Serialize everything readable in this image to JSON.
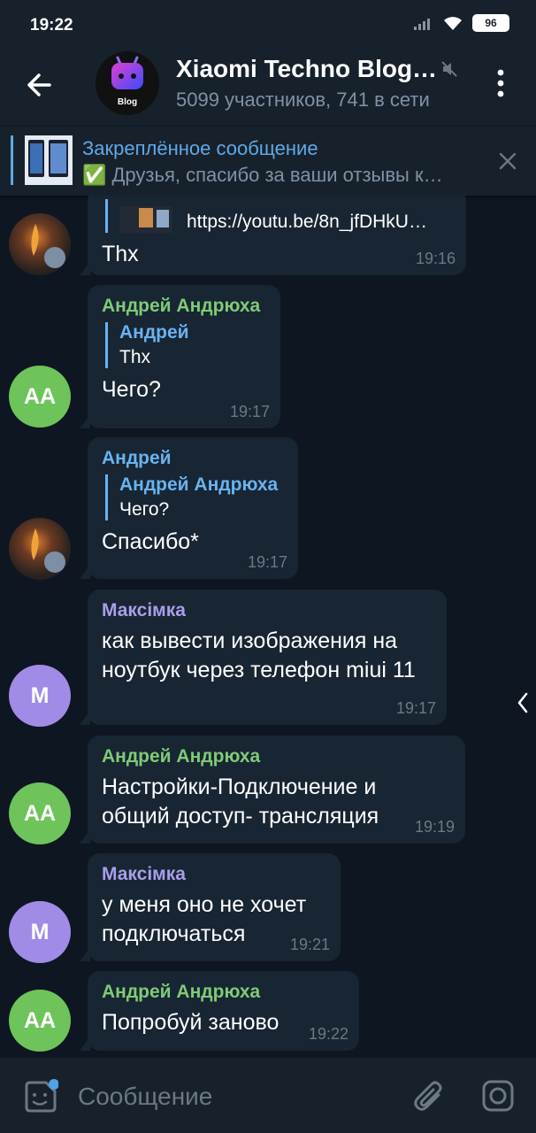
{
  "status_bar": {
    "time": "19:22",
    "battery": "96"
  },
  "header": {
    "title": "Xiaomi Techno Blog…",
    "subtitle": "5099 участников, 741 в сети",
    "avatar_text": "Blog"
  },
  "pinned": {
    "title": "Закреплённое сообщение",
    "text": "✅ Друзья, спасибо за ваши отзывы к…"
  },
  "messages": [
    {
      "avatar": "photo",
      "reply_partial": "https://youtu.be/8n_jfDHkU…",
      "text": "Thx",
      "time": "19:16"
    },
    {
      "avatar": "АА",
      "sender": "Андрей Андрюха",
      "reply_name": "Андрей",
      "reply_text": "Thx",
      "text": "Чего?",
      "time": "19:17"
    },
    {
      "avatar": "photo",
      "sender": "Андрей",
      "reply_name": "Андрей Андрюха",
      "reply_text": "Чего?",
      "text": "Спасибо*",
      "time": "19:17"
    },
    {
      "avatar": "М",
      "sender": "Максімка",
      "text": "как вывести изображения на ноутбук  через телефон miui 11",
      "time": "19:17"
    },
    {
      "avatar": "АА",
      "sender": "Андрей Андрюха",
      "text": "Настройки-Подключение и общий доступ- трансляция",
      "time": "19:19"
    },
    {
      "avatar": "М",
      "sender": "Максімка",
      "text": "у меня оно не хочет подключаться",
      "time": "19:21"
    },
    {
      "avatar": "АА",
      "sender": "Андрей Андрюха",
      "text": "Попробуй заново",
      "time": "19:22"
    }
  ],
  "input": {
    "placeholder": "Сообщение"
  },
  "colors": {
    "background": "#0e1621",
    "panel": "#17212b",
    "bubble": "#182533",
    "accent": "#5fa9e8",
    "green_name": "#7ecb76",
    "purple_name": "#a99ee8",
    "green_avatar": "#6ec35b",
    "purple_avatar": "#a08ce6"
  },
  "icons": {
    "back": "arrow-left-icon",
    "mute": "mute-icon",
    "menu": "dots-vertical-icon",
    "close": "close-icon",
    "sticker": "sticker-icon",
    "attach": "paperclip-icon",
    "camera": "camera-icon"
  }
}
